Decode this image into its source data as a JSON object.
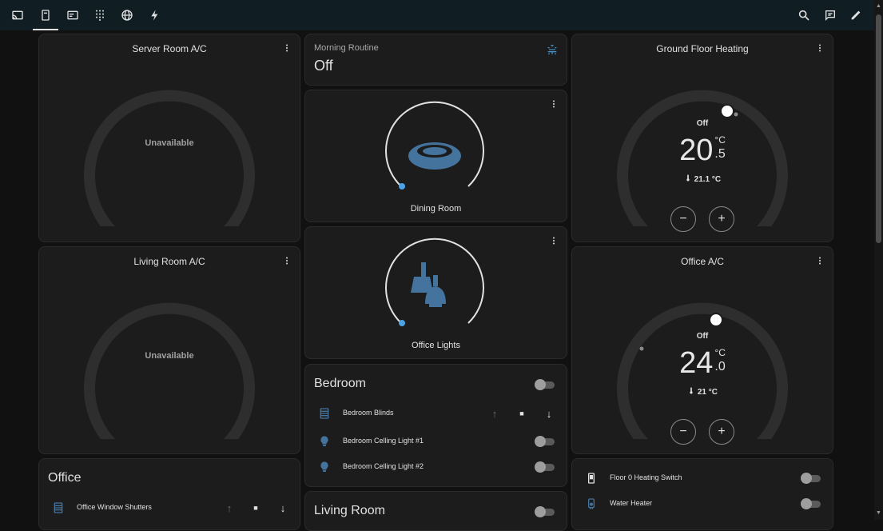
{
  "toolbar": {
    "tabs": [
      {
        "icon": "cast-icon"
      },
      {
        "icon": "tablet-icon"
      },
      {
        "icon": "card-icon"
      },
      {
        "icon": "grid-icon"
      },
      {
        "icon": "globe-icon"
      },
      {
        "icon": "lightning-icon"
      }
    ],
    "active_tab": 1,
    "actions": [
      {
        "icon": "search-icon"
      },
      {
        "icon": "chat-icon"
      },
      {
        "icon": "pencil-icon"
      }
    ]
  },
  "server_room_ac": {
    "title": "Server Room A/C",
    "status": "Unavailable"
  },
  "living_room_ac": {
    "title": "Living Room A/C",
    "status": "Unavailable"
  },
  "office": {
    "title": "Office",
    "rows": [
      {
        "name": "Office Window Shutters",
        "icon": "blinds-icon"
      }
    ]
  },
  "morning_routine": {
    "label": "Morning Routine",
    "state": "Off",
    "icon": "sun-snow-icon"
  },
  "dining_room": {
    "label": "Dining Room",
    "icon": "ceiling-light-icon",
    "brightness": 0
  },
  "office_lights": {
    "label": "Office Lights",
    "icon": "pendant-lights-icon",
    "brightness": 0
  },
  "bedroom": {
    "title": "Bedroom",
    "rows": [
      {
        "name": "Bedroom Blinds",
        "icon": "blinds-icon",
        "type": "cover"
      },
      {
        "name": "Bedroom Celling Light #1",
        "icon": "bulb-icon",
        "type": "toggle"
      },
      {
        "name": "Bedroom Celling Light #2",
        "icon": "bulb-icon",
        "type": "toggle"
      }
    ]
  },
  "living_room": {
    "title": "Living Room"
  },
  "ground_floor_heating": {
    "title": "Ground Floor Heating",
    "mode": "Off",
    "target_int": "20",
    "target_dec": ".5",
    "unit": "°C",
    "current": "21.1 °C"
  },
  "office_ac": {
    "title": "Office A/C",
    "mode": "Off",
    "target_int": "24",
    "target_dec": ".0",
    "unit": "°C",
    "current": "21 °C"
  },
  "switches": {
    "rows": [
      {
        "name": "Floor 0 Heating Switch",
        "icon": "switch-icon"
      },
      {
        "name": "Water Heater",
        "icon": "water-heater-icon"
      }
    ]
  },
  "colors": {
    "accent": "#4ba3e3",
    "icon_blue": "#44739e",
    "card": "#1c1c1c",
    "background": "#111111"
  },
  "controls": {
    "minus": "−",
    "plus": "+",
    "up": "↑",
    "stop": "■",
    "down": "↓"
  }
}
